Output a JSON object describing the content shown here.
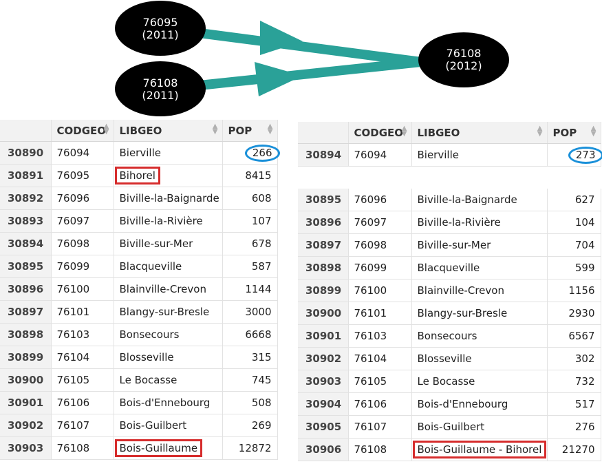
{
  "diagram": {
    "nodes": [
      {
        "code": "76095",
        "year": "(2011)"
      },
      {
        "code": "76108",
        "year": "(2011)"
      },
      {
        "code": "76108",
        "year": "(2012)"
      }
    ],
    "edge_color": "#2aa198",
    "node_color": "#000000"
  },
  "left_table": {
    "headers": [
      "",
      "CODGEO",
      "LIBGEO",
      "POP"
    ],
    "rows": [
      {
        "idx": "30890",
        "codgeo": "76094",
        "libgeo": "Bierville",
        "pop": "266"
      },
      {
        "idx": "30891",
        "codgeo": "76095",
        "libgeo": "Bihorel",
        "pop": "8415"
      },
      {
        "idx": "30892",
        "codgeo": "76096",
        "libgeo": "Biville-la-Baignarde",
        "pop": "608"
      },
      {
        "idx": "30893",
        "codgeo": "76097",
        "libgeo": "Biville-la-Rivière",
        "pop": "107"
      },
      {
        "idx": "30894",
        "codgeo": "76098",
        "libgeo": "Biville-sur-Mer",
        "pop": "678"
      },
      {
        "idx": "30895",
        "codgeo": "76099",
        "libgeo": "Blacqueville",
        "pop": "587"
      },
      {
        "idx": "30896",
        "codgeo": "76100",
        "libgeo": "Blainville-Crevon",
        "pop": "1144"
      },
      {
        "idx": "30897",
        "codgeo": "76101",
        "libgeo": "Blangy-sur-Bresle",
        "pop": "3000"
      },
      {
        "idx": "30898",
        "codgeo": "76103",
        "libgeo": "Bonsecours",
        "pop": "6668"
      },
      {
        "idx": "30899",
        "codgeo": "76104",
        "libgeo": "Blosseville",
        "pop": "315"
      },
      {
        "idx": "30900",
        "codgeo": "76105",
        "libgeo": "Le Bocasse",
        "pop": "745"
      },
      {
        "idx": "30901",
        "codgeo": "76106",
        "libgeo": "Bois-d'Ennebourg",
        "pop": "508"
      },
      {
        "idx": "30902",
        "codgeo": "76107",
        "libgeo": "Bois-Guilbert",
        "pop": "269"
      },
      {
        "idx": "30903",
        "codgeo": "76108",
        "libgeo": "Bois-Guillaume",
        "pop": "12872"
      }
    ]
  },
  "right_table": {
    "headers": [
      "",
      "CODGEO",
      "LIBGEO",
      "POP"
    ],
    "rows": [
      {
        "idx": "30894",
        "codgeo": "76094",
        "libgeo": "Bierville",
        "pop": "273"
      },
      {
        "idx": "30895",
        "codgeo": "76096",
        "libgeo": "Biville-la-Baignarde",
        "pop": "627"
      },
      {
        "idx": "30896",
        "codgeo": "76097",
        "libgeo": "Biville-la-Rivière",
        "pop": "104"
      },
      {
        "idx": "30897",
        "codgeo": "76098",
        "libgeo": "Biville-sur-Mer",
        "pop": "704"
      },
      {
        "idx": "30898",
        "codgeo": "76099",
        "libgeo": "Blacqueville",
        "pop": "599"
      },
      {
        "idx": "30899",
        "codgeo": "76100",
        "libgeo": "Blainville-Crevon",
        "pop": "1156"
      },
      {
        "idx": "30900",
        "codgeo": "76101",
        "libgeo": "Blangy-sur-Bresle",
        "pop": "2930"
      },
      {
        "idx": "30901",
        "codgeo": "76103",
        "libgeo": "Bonsecours",
        "pop": "6567"
      },
      {
        "idx": "30902",
        "codgeo": "76104",
        "libgeo": "Blosseville",
        "pop": "302"
      },
      {
        "idx": "30903",
        "codgeo": "76105",
        "libgeo": "Le Bocasse",
        "pop": "732"
      },
      {
        "idx": "30904",
        "codgeo": "76106",
        "libgeo": "Bois-d'Ennebourg",
        "pop": "517"
      },
      {
        "idx": "30905",
        "codgeo": "76107",
        "libgeo": "Bois-Guilbert",
        "pop": "276"
      },
      {
        "idx": "30906",
        "codgeo": "76108",
        "libgeo": "Bois-Guillaume - Bihorel",
        "pop": "21270"
      }
    ]
  }
}
